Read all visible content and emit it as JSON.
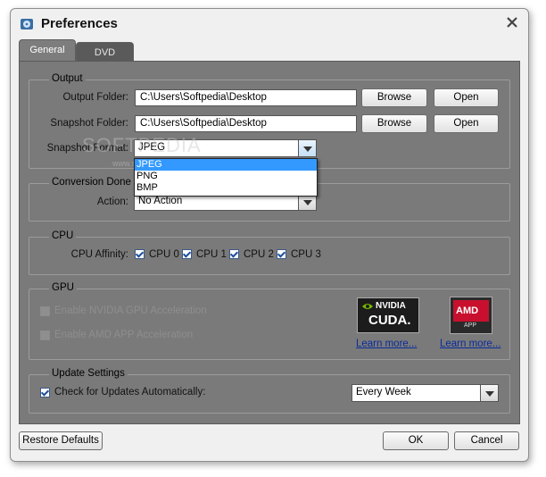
{
  "window": {
    "title": "Preferences",
    "app_icon": "disc-app-icon",
    "close_icon": "close-icon"
  },
  "tabs": [
    {
      "label": "General",
      "active": true
    },
    {
      "label": "DVD",
      "active": false
    }
  ],
  "output": {
    "group_title": "Output",
    "output_folder_label": "Output Folder:",
    "output_folder_value": "C:\\Users\\Softpedia\\Desktop",
    "snapshot_folder_label": "Snapshot Folder:",
    "snapshot_folder_value": "C:\\Users\\Softpedia\\Desktop",
    "browse_label": "Browse",
    "open_label": "Open",
    "snapshot_format_label": "Snapshot Format:",
    "snapshot_format_value": "JPEG",
    "snapshot_format_options": [
      "JPEG",
      "PNG",
      "BMP"
    ]
  },
  "conversion": {
    "group_title": "Conversion Done",
    "action_label": "Action:",
    "action_value": "No Action"
  },
  "cpu": {
    "group_title": "CPU",
    "affinity_label": "CPU Affinity:",
    "cores": [
      {
        "label": "CPU 0",
        "checked": true
      },
      {
        "label": "CPU 1",
        "checked": true
      },
      {
        "label": "CPU 2",
        "checked": true
      },
      {
        "label": "CPU 3",
        "checked": true
      }
    ]
  },
  "gpu": {
    "group_title": "GPU",
    "nvidia_label": "Enable NVIDIA GPU Acceleration",
    "amd_label": "Enable AMD APP Acceleration",
    "nvidia_logo_text": "NVIDIA",
    "nvidia_logo_sub": "CUDA.",
    "amd_logo_text": "AMD",
    "amd_logo_sub": "APP",
    "learn_more": "Learn more..."
  },
  "update": {
    "group_title": "Update Settings",
    "check_label": "Check for Updates Automatically:",
    "checked": true,
    "frequency_value": "Every Week"
  },
  "footer": {
    "restore_label": "Restore Defaults",
    "ok_label": "OK",
    "cancel_label": "Cancel"
  },
  "watermark": {
    "text": "SOFTPEDIA",
    "sub": "www.softpedia.com"
  },
  "colors": {
    "panel": "#7a7a7a",
    "selection": "#3399ff",
    "link": "#0a2b9c"
  }
}
